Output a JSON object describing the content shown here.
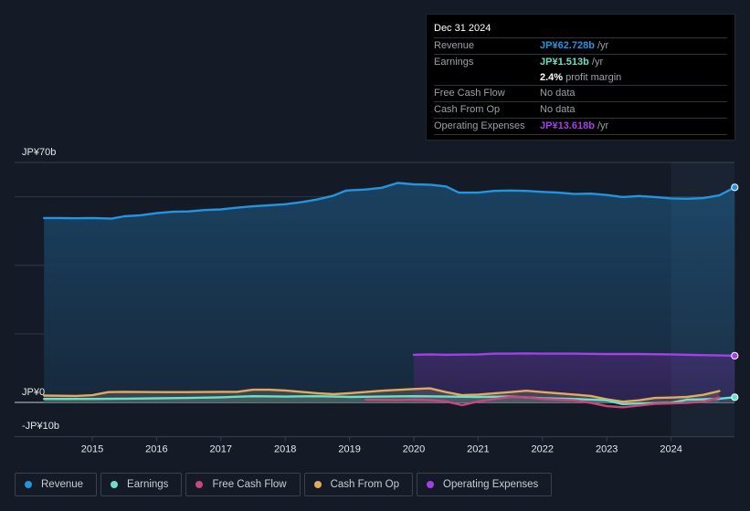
{
  "tooltip": {
    "date": "Dec 31 2024",
    "rows": [
      {
        "label": "Revenue",
        "value": "JP¥62.728b",
        "suffix": " /yr",
        "color": "#2394df"
      },
      {
        "label": "Earnings",
        "value": "JP¥1.513b",
        "suffix": " /yr",
        "color": "#6be0c9"
      },
      {
        "label": "",
        "value": "2.4%",
        "suffix": " profit margin",
        "color": "#ffffff"
      },
      {
        "label": "Free Cash Flow",
        "value": "",
        "suffix": "No data",
        "color": "#6c727a"
      },
      {
        "label": "Cash From Op",
        "value": "",
        "suffix": "No data",
        "color": "#6c727a"
      },
      {
        "label": "Operating Expenses",
        "value": "JP¥13.618b",
        "suffix": " /yr",
        "color": "#a53fe8"
      }
    ]
  },
  "legend": [
    {
      "label": "Revenue",
      "color": "#2394df"
    },
    {
      "label": "Earnings",
      "color": "#6be0c9"
    },
    {
      "label": "Free Cash Flow",
      "color": "#c9467f"
    },
    {
      "label": "Cash From Op",
      "color": "#e5a95c"
    },
    {
      "label": "Operating Expenses",
      "color": "#a53fe8"
    }
  ],
  "chart_data": {
    "type": "area",
    "title": "",
    "xlabel": "",
    "ylabel": "",
    "y_unit": "JP¥ billions",
    "ylim": [
      -10,
      70
    ],
    "xlim": [
      2014.25,
      2025.0
    ],
    "y_tick_labels": [
      {
        "value": 70,
        "label": "JP¥70b"
      },
      {
        "value": 0,
        "label": "JP¥0"
      },
      {
        "value": -10,
        "label": "-JP¥10b"
      }
    ],
    "x_tick_labels": [
      "2015",
      "2016",
      "2017",
      "2018",
      "2019",
      "2020",
      "2021",
      "2022",
      "2023",
      "2024"
    ],
    "x_ticks": [
      2015,
      2016,
      2017,
      2018,
      2019,
      2020,
      2021,
      2022,
      2023,
      2024
    ],
    "gridlines_y": [
      60,
      40,
      20
    ],
    "forecast_highlight_start": 2024.0,
    "grid": true,
    "legend_position": "bottom-left",
    "series": [
      {
        "name": "Revenue",
        "color": "#2394df",
        "points": [
          [
            2014.25,
            53.8
          ],
          [
            2014.5,
            53.8
          ],
          [
            2014.75,
            53.7
          ],
          [
            2015.0,
            53.8
          ],
          [
            2015.3,
            53.6
          ],
          [
            2015.5,
            54.3
          ],
          [
            2015.75,
            54.6
          ],
          [
            2016.0,
            55.2
          ],
          [
            2016.25,
            55.6
          ],
          [
            2016.5,
            55.7
          ],
          [
            2016.75,
            56.1
          ],
          [
            2017.0,
            56.3
          ],
          [
            2017.25,
            56.8
          ],
          [
            2017.5,
            57.2
          ],
          [
            2017.75,
            57.5
          ],
          [
            2018.0,
            57.8
          ],
          [
            2018.25,
            58.4
          ],
          [
            2018.5,
            59.2
          ],
          [
            2018.75,
            60.3
          ],
          [
            2018.95,
            61.8
          ],
          [
            2019.25,
            62.1
          ],
          [
            2019.5,
            62.6
          ],
          [
            2019.75,
            64.0
          ],
          [
            2020.0,
            63.6
          ],
          [
            2020.25,
            63.5
          ],
          [
            2020.5,
            63.0
          ],
          [
            2020.7,
            61.2
          ],
          [
            2021.0,
            61.2
          ],
          [
            2021.25,
            61.7
          ],
          [
            2021.5,
            61.8
          ],
          [
            2021.75,
            61.7
          ],
          [
            2022.0,
            61.4
          ],
          [
            2022.25,
            61.2
          ],
          [
            2022.5,
            60.8
          ],
          [
            2022.75,
            60.9
          ],
          [
            2023.0,
            60.5
          ],
          [
            2023.25,
            59.9
          ],
          [
            2023.5,
            60.2
          ],
          [
            2023.75,
            59.9
          ],
          [
            2024.0,
            59.5
          ],
          [
            2024.25,
            59.4
          ],
          [
            2024.5,
            59.6
          ],
          [
            2024.75,
            60.4
          ],
          [
            2024.99,
            62.728
          ]
        ]
      },
      {
        "name": "Earnings",
        "color": "#6be0c9",
        "points": [
          [
            2014.25,
            1.0
          ],
          [
            2015.0,
            1.0
          ],
          [
            2015.5,
            1.1
          ],
          [
            2016.0,
            1.2
          ],
          [
            2016.5,
            1.3
          ],
          [
            2017.0,
            1.5
          ],
          [
            2017.5,
            1.8
          ],
          [
            2018.0,
            1.7
          ],
          [
            2018.5,
            1.8
          ],
          [
            2019.0,
            1.6
          ],
          [
            2019.5,
            1.7
          ],
          [
            2020.0,
            1.8
          ],
          [
            2020.5,
            1.7
          ],
          [
            2021.0,
            1.6
          ],
          [
            2021.5,
            1.7
          ],
          [
            2022.0,
            1.2
          ],
          [
            2022.5,
            1.0
          ],
          [
            2023.0,
            0.6
          ],
          [
            2023.25,
            -0.5
          ],
          [
            2023.5,
            -0.3
          ],
          [
            2023.75,
            -0.2
          ],
          [
            2024.0,
            -0.1
          ],
          [
            2024.25,
            0.8
          ],
          [
            2024.5,
            0.9
          ],
          [
            2024.75,
            1.1
          ],
          [
            2024.99,
            1.513
          ]
        ]
      },
      {
        "name": "Free Cash Flow",
        "color": "#c9467f",
        "points": [
          [
            2019.25,
            0.8
          ],
          [
            2019.75,
            0.7
          ],
          [
            2020.0,
            0.8
          ],
          [
            2020.25,
            0.7
          ],
          [
            2020.5,
            0.3
          ],
          [
            2020.75,
            -0.8
          ],
          [
            2021.0,
            0.3
          ],
          [
            2021.25,
            1.0
          ],
          [
            2021.5,
            1.6
          ],
          [
            2021.75,
            1.5
          ],
          [
            2022.0,
            1.0
          ],
          [
            2022.25,
            0.8
          ],
          [
            2022.5,
            0.6
          ],
          [
            2022.75,
            -0.1
          ],
          [
            2023.0,
            -1.1
          ],
          [
            2023.25,
            -1.4
          ],
          [
            2023.5,
            -0.9
          ],
          [
            2023.75,
            -0.4
          ],
          [
            2024.0,
            -0.3
          ],
          [
            2024.25,
            -0.1
          ],
          [
            2024.5,
            0.2
          ],
          [
            2024.75,
            1.4
          ]
        ]
      },
      {
        "name": "Cash From Op",
        "color": "#e5a95c",
        "points": [
          [
            2014.25,
            2.0
          ],
          [
            2014.75,
            1.9
          ],
          [
            2015.0,
            2.1
          ],
          [
            2015.25,
            3.0
          ],
          [
            2015.5,
            3.1
          ],
          [
            2016.0,
            3.0
          ],
          [
            2016.5,
            3.0
          ],
          [
            2017.0,
            3.1
          ],
          [
            2017.25,
            3.1
          ],
          [
            2017.5,
            3.7
          ],
          [
            2017.75,
            3.7
          ],
          [
            2018.0,
            3.5
          ],
          [
            2018.5,
            2.7
          ],
          [
            2018.75,
            2.4
          ],
          [
            2019.0,
            2.7
          ],
          [
            2019.5,
            3.4
          ],
          [
            2020.0,
            3.9
          ],
          [
            2020.25,
            4.1
          ],
          [
            2020.5,
            3.0
          ],
          [
            2020.75,
            2.1
          ],
          [
            2021.0,
            2.3
          ],
          [
            2021.5,
            3.0
          ],
          [
            2021.75,
            3.4
          ],
          [
            2022.0,
            3.0
          ],
          [
            2022.5,
            2.3
          ],
          [
            2022.75,
            1.9
          ],
          [
            2023.0,
            0.9
          ],
          [
            2023.25,
            0.2
          ],
          [
            2023.5,
            0.6
          ],
          [
            2023.75,
            1.3
          ],
          [
            2024.0,
            1.4
          ],
          [
            2024.25,
            1.6
          ],
          [
            2024.5,
            2.2
          ],
          [
            2024.75,
            3.3
          ]
        ]
      },
      {
        "name": "Operating Expenses",
        "color": "#a53fe8",
        "points": [
          [
            2020.0,
            13.9
          ],
          [
            2020.25,
            14.0
          ],
          [
            2020.5,
            13.9
          ],
          [
            2021.0,
            14.0
          ],
          [
            2021.25,
            14.2
          ],
          [
            2021.5,
            14.2
          ],
          [
            2021.75,
            14.3
          ],
          [
            2022.0,
            14.2
          ],
          [
            2022.5,
            14.2
          ],
          [
            2023.0,
            14.1
          ],
          [
            2023.5,
            14.1
          ],
          [
            2024.0,
            14.0
          ],
          [
            2024.5,
            13.8
          ],
          [
            2024.99,
            13.618
          ]
        ]
      }
    ]
  }
}
